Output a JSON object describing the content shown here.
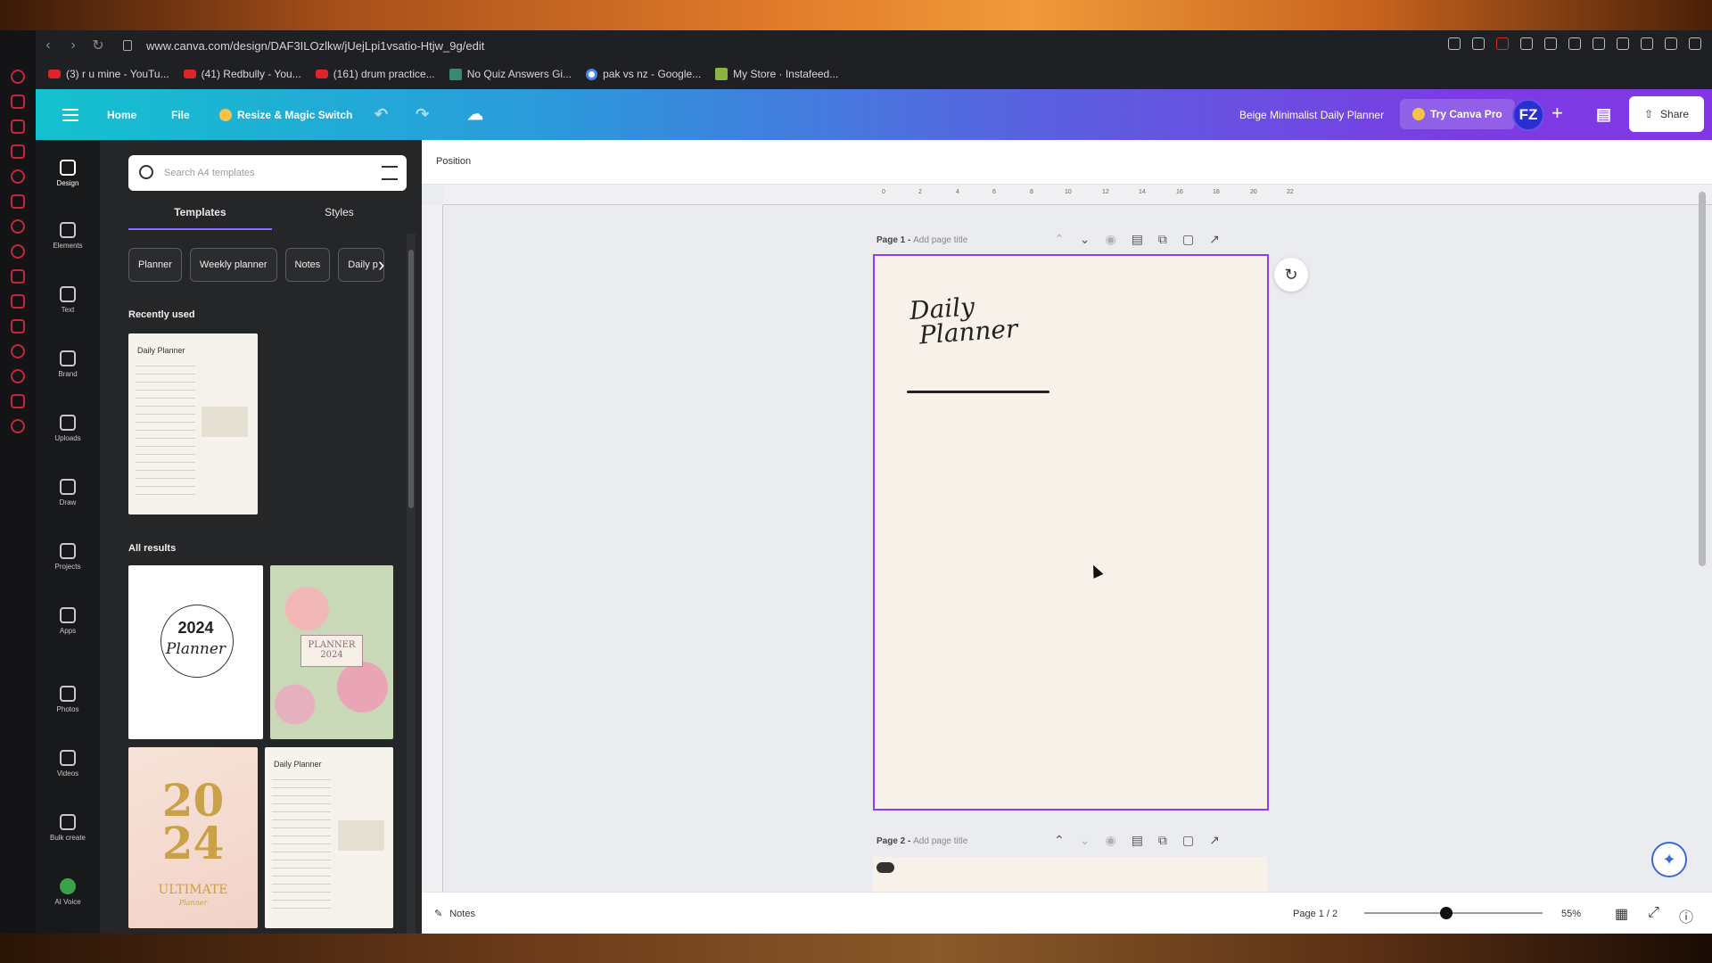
{
  "browser": {
    "url": "www.canva.com/design/DAF3ILOzlkw/jUejLpi1vsatio-Htjw_9g/edit",
    "bookmarks": [
      "(3) r u mine - YouTu...",
      "(41) Redbully - You...",
      "(161) drum practice...",
      "No Quiz Answers Gi...",
      "pak vs nz - Google...",
      "My Store · Instafeed..."
    ]
  },
  "header": {
    "home": "Home",
    "file": "File",
    "resize": "Resize & Magic Switch",
    "design_title": "Beige Minimalist Daily Planner",
    "try_pro": "Try Canva Pro",
    "avatar": "FZ",
    "plus": "+",
    "share": "Share"
  },
  "rail": {
    "items": [
      "Design",
      "Elements",
      "Text",
      "Brand",
      "Uploads",
      "Draw",
      "Projects",
      "Apps",
      "Photos",
      "Videos",
      "Bulk create",
      "AI Voice"
    ]
  },
  "panel": {
    "search_placeholder": "Search A4 templates",
    "tabs": [
      "Templates",
      "Styles"
    ],
    "chips": [
      "Planner",
      "Weekly planner",
      "Notes",
      "Daily p"
    ],
    "recently_used": "Recently used",
    "all_results": "All results",
    "thumb_recent_title": "Daily Planner",
    "thumb1_year": "2024",
    "thumb1_word": "Planner",
    "thumb2_text": "PLANNER",
    "thumb2_year": "2024",
    "thumb3_top": "20",
    "thumb3_bottom": "24",
    "thumb3_sub": "ULTIMATE",
    "thumb3_sub2": "Planner",
    "thumb4_title": "Daily Planner"
  },
  "toolbar": {
    "position": "Position"
  },
  "ruler": {
    "ticks": [
      "0",
      "2",
      "4",
      "6",
      "8",
      "10",
      "12",
      "14",
      "16",
      "18",
      "20",
      "22"
    ]
  },
  "pages": {
    "page1_label": "Page 1 - ",
    "page1_title_placeholder": "Add page title",
    "page2_label": "Page 2 - ",
    "page2_title_placeholder": "Add page title"
  },
  "design": {
    "title_line1": "Daily",
    "title_line2": "Planner"
  },
  "footer": {
    "notes": "Notes",
    "page_counter": "Page 1 / 2",
    "zoom": "55%",
    "zoom_level": 0.55
  },
  "colors": {
    "selection": "#8b3dff",
    "page_bg": "#f7f1ea",
    "accent": "#8b6ef0"
  }
}
